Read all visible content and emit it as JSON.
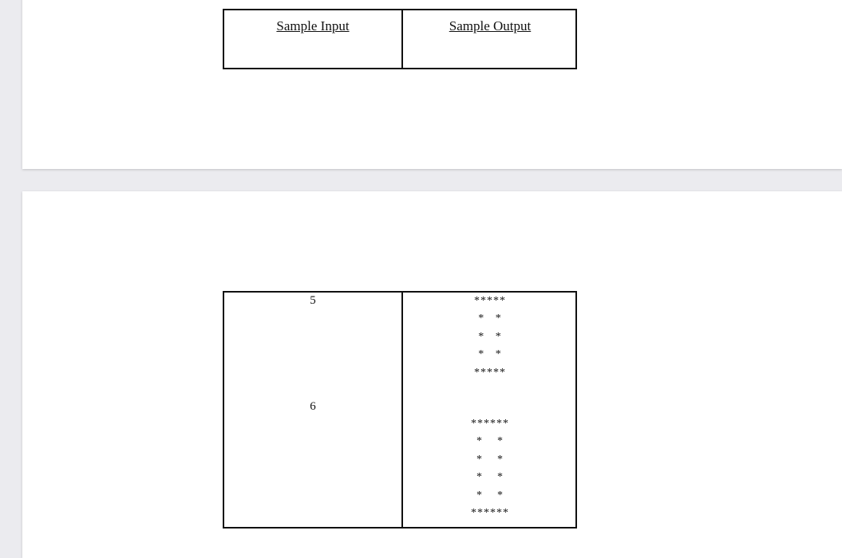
{
  "header_table": {
    "input_header": "Sample Input",
    "output_header": "Sample Output"
  },
  "sample_table": {
    "inputs": [
      "5",
      "6"
    ],
    "outputs": [
      [
        "*****",
        "*   *",
        "*   *",
        "*   *",
        "*****"
      ],
      [
        "******",
        "*    *",
        "*    *",
        "*    *",
        "*    *",
        "******"
      ]
    ]
  }
}
